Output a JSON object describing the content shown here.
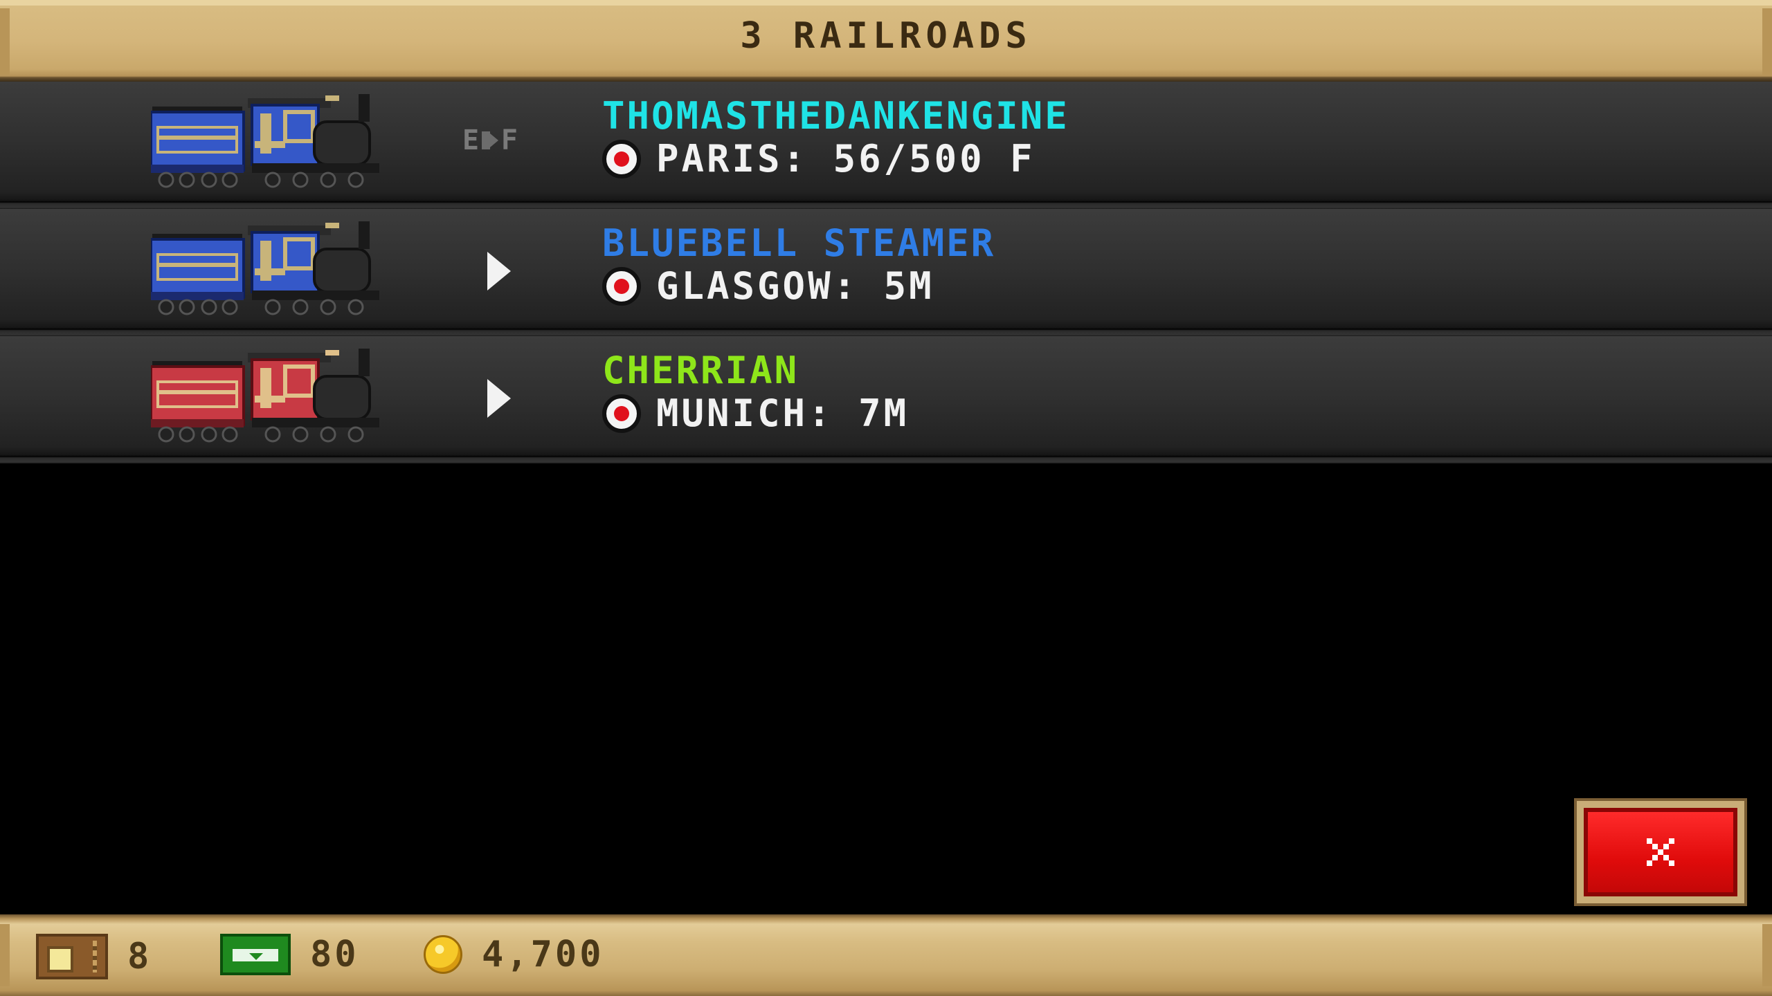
{
  "header": {
    "title": "3 RAILROADS"
  },
  "railroads": [
    {
      "name": "THOMASTHEDANKENGINE",
      "name_color": "#1fe3e6",
      "train_color": "blue",
      "indicator": "fuel-gauge",
      "fuel_gauge": {
        "empty_label": "E",
        "full_label": "F"
      },
      "status_icon": "signal-icon",
      "status": "PARIS: 56/500 F"
    },
    {
      "name": "BLUEBELL STEAMER",
      "name_color": "#2f7de6",
      "train_color": "blue",
      "indicator": "play-arrow",
      "status_icon": "signal-icon",
      "status": "GLASGOW: 5M"
    },
    {
      "name": "CHERRIAN",
      "name_color": "#8ee61a",
      "train_color": "red",
      "indicator": "play-arrow",
      "status_icon": "signal-icon",
      "status": "MUNICH: 7M"
    }
  ],
  "close_button": {
    "icon": "close-icon"
  },
  "footer": {
    "tickets": {
      "icon": "ticket-icon",
      "value": "8"
    },
    "cash": {
      "icon": "cash-icon",
      "value": "80"
    },
    "coins": {
      "icon": "coin-icon",
      "value": "4,700"
    }
  },
  "colors": {
    "banner": "#d4b57a",
    "row": "#2f2f2f",
    "close": "#e00b0b"
  }
}
